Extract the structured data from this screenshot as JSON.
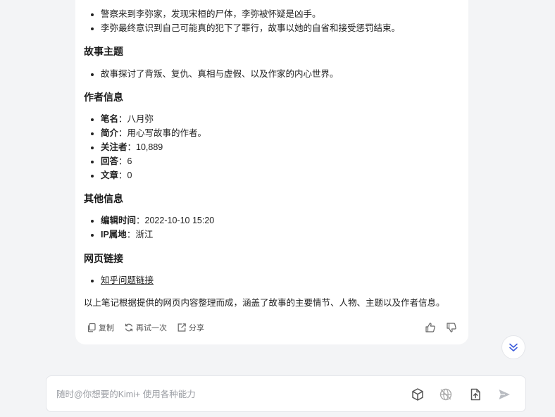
{
  "story_events": [
    "警察来到李弥家，发现宋桓的尸体，李弥被怀疑是凶手。",
    "李弥最终意识到自己可能真的犯下了罪行，故事以她的自省和接受惩罚结束。"
  ],
  "theme": {
    "title": "故事主题",
    "items": [
      "故事探讨了背叛、复仇、真相与虚假、以及作家的内心世界。"
    ]
  },
  "author": {
    "title": "作者信息",
    "items": [
      {
        "key": "笔名",
        "sep": "：",
        "value": "八月弥"
      },
      {
        "key": "简介",
        "sep": "：",
        "value": "用心写故事的作者。"
      },
      {
        "key": "关注者",
        "sep": "：",
        "value": "10,889"
      },
      {
        "key": "回答",
        "sep": "：",
        "value": "6"
      },
      {
        "key": "文章",
        "sep": "：",
        "value": "0"
      }
    ]
  },
  "other": {
    "title": "其他信息",
    "items": [
      {
        "key": "编辑时间",
        "sep": "：",
        "value": "2022-10-10 15:20"
      },
      {
        "key": "IP属地",
        "sep": "：",
        "value": "浙江"
      }
    ]
  },
  "links": {
    "title": "网页链接",
    "items": [
      "知乎问题链接"
    ]
  },
  "summary": "以上笔记根据提供的网页内容整理而成，涵盖了故事的主要情节、人物、主题以及作者信息。",
  "actions": {
    "copy": "复制",
    "retry": "再试一次",
    "share": "分享"
  },
  "input": {
    "placeholder": "随时@你想要的Kimi+ 使用各种能力"
  },
  "colors": {
    "accent": "#3b5bdb",
    "icon": "#666666",
    "send_disabled": "#b9bcc2"
  }
}
